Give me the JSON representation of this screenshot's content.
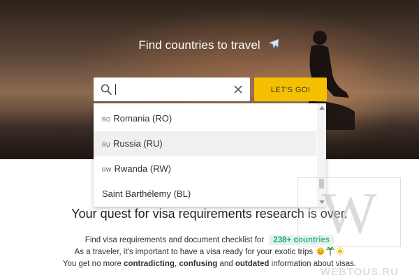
{
  "hero": {
    "title": "Find countries to travel",
    "plane_icon": "airplane-icon"
  },
  "search": {
    "value": "",
    "placeholder": "",
    "search_icon": "search-icon",
    "clear_icon": "close-icon"
  },
  "go_button": {
    "label": "LET'S GO!"
  },
  "dropdown": {
    "items": [
      {
        "code": "RO",
        "label": "Romania (RO)",
        "highlighted": false
      },
      {
        "code": "RU",
        "label": "Russia (RU)",
        "highlighted": true
      },
      {
        "code": "RW",
        "label": "Rwanda (RW)",
        "highlighted": false
      },
      {
        "code": "",
        "label": "Saint Barthélemy (BL)",
        "highlighted": false
      }
    ]
  },
  "content": {
    "headline": "Your quest for visa requirements research is over.",
    "line1_prefix": "Find visa requirements and document checklist for",
    "count_badge": "238+ countries",
    "line2": "As a traveler, it's important to have a visa ready for your exotic trips",
    "line3_part1": "You get no more",
    "line3_bold1": "contradicting",
    "line3_sep1": ",",
    "line3_bold2": "confusing",
    "line3_and": "and",
    "line3_bold3": "outdated",
    "line3_end": "information about visas."
  },
  "watermark": {
    "letter": "W",
    "text": "WEBTOUS.RU"
  },
  "colors": {
    "accent": "#f5c000",
    "badge_text": "#1aa386",
    "badge_bg": "#e2f3ee"
  }
}
